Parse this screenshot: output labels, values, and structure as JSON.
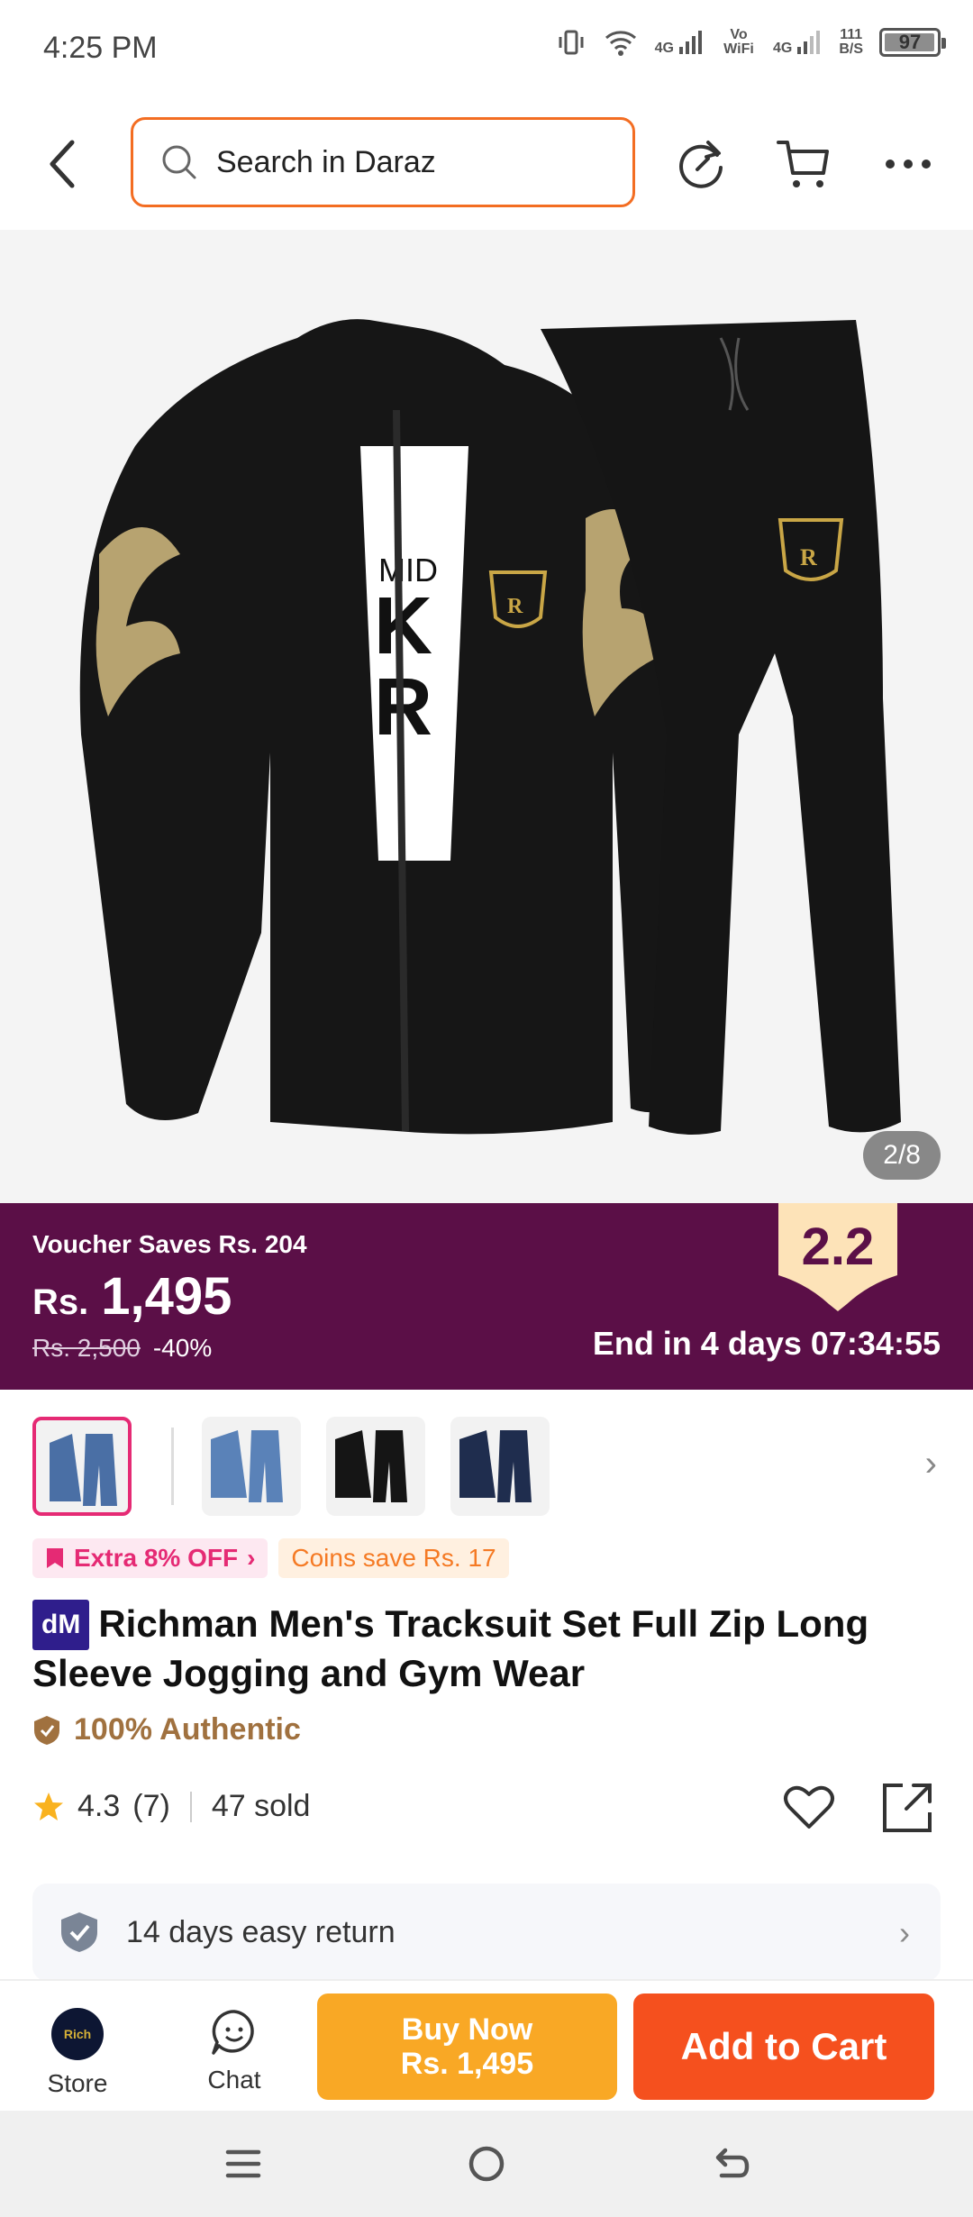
{
  "status_bar": {
    "time": "4:25 PM",
    "net1": "4G",
    "volte": "Vo WiFi",
    "net2": "4G",
    "speed_top": "111",
    "speed_unit": "B/S",
    "battery": "97",
    "battery_level": 0.97
  },
  "header": {
    "search_placeholder": "Search in Daraz",
    "icons": [
      "back-icon",
      "search-icon",
      "share-refresh-icon",
      "cart-icon",
      "more-icon"
    ]
  },
  "gallery": {
    "counter": "2/8"
  },
  "promo": {
    "voucher": "Voucher Saves Rs. 204",
    "currency": "Rs.",
    "price": "1,495",
    "original_price": "Rs. 2,500",
    "discount": "-40%",
    "campaign": "2.2",
    "countdown": "End in 4 days 07:34:55",
    "bg_color": "#5b0f47"
  },
  "tags": {
    "extra": "Extra 8% OFF",
    "coins": "Coins save Rs. 17"
  },
  "product": {
    "brand_badge": "dM",
    "title": "Richman Men's Tracksuit Set Full Zip Long Sleeve Jogging and Gym Wear",
    "authentic": "100% Authentic",
    "rating": "4.3",
    "reviews": "(7)",
    "sold": "47 sold"
  },
  "returns": {
    "label": "14 days easy return"
  },
  "bottom_bar": {
    "store_label": "Store",
    "store_logo_text": "Rich",
    "chat_label": "Chat",
    "buy_now_label": "Buy Now",
    "buy_now_price": "Rs. 1,495",
    "add_to_cart_label": "Add to Cart",
    "buy_color": "#f9a825",
    "cart_color": "#f5501e"
  }
}
